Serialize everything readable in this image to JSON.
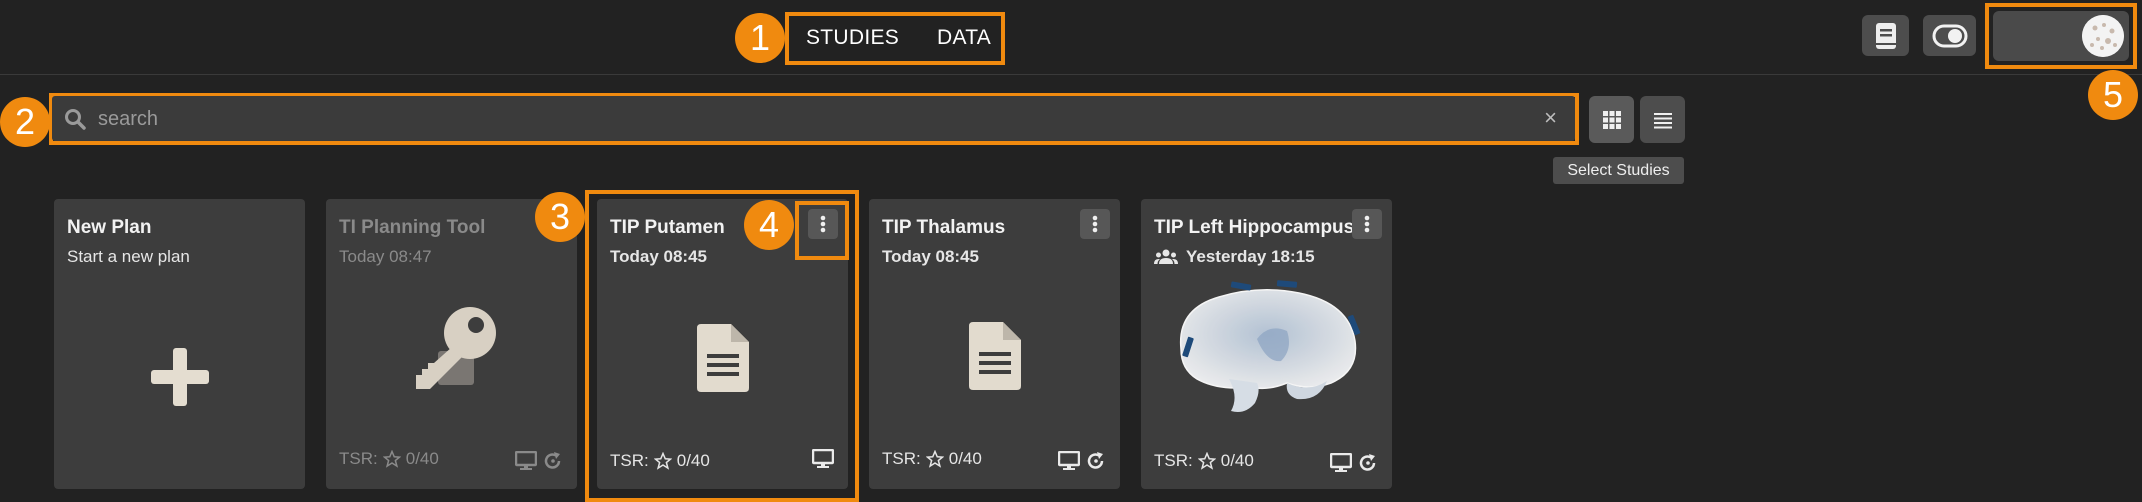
{
  "nav": {
    "studies_label": "STUDIES",
    "data_label": "DATA"
  },
  "search": {
    "placeholder": "search",
    "clear_label": "×"
  },
  "toolbar": {
    "select_studies_label": "Select Studies"
  },
  "markers": [
    "1",
    "2",
    "3",
    "4",
    "5"
  ],
  "cards": [
    {
      "title": "New Plan",
      "subtitle": "Start a new plan",
      "icon": "plus-icon"
    },
    {
      "title": "TI Planning Tool",
      "subtitle": "Today 08:47",
      "icon": "key-icon",
      "tsr_label": "TSR:",
      "tsr_value": "0/40"
    },
    {
      "title": "TIP Putamen",
      "subtitle": "Today 08:45",
      "icon": "document-icon",
      "tsr_label": "TSR:",
      "tsr_value": "0/40"
    },
    {
      "title": "TIP Thalamus",
      "subtitle": "Today 08:45",
      "icon": "document-icon",
      "tsr_label": "TSR:",
      "tsr_value": "0/40"
    },
    {
      "title": "TIP Left Hippocampus",
      "subtitle": "Yesterday 18:15",
      "icon": "brain-thumbnail",
      "tsr_label": "TSR:",
      "tsr_value": "0/40"
    }
  ],
  "colors": {
    "highlight": "#f08a0f",
    "background": "#222222",
    "card": "#3d3d3d",
    "electrode": "#1e4a7a"
  }
}
